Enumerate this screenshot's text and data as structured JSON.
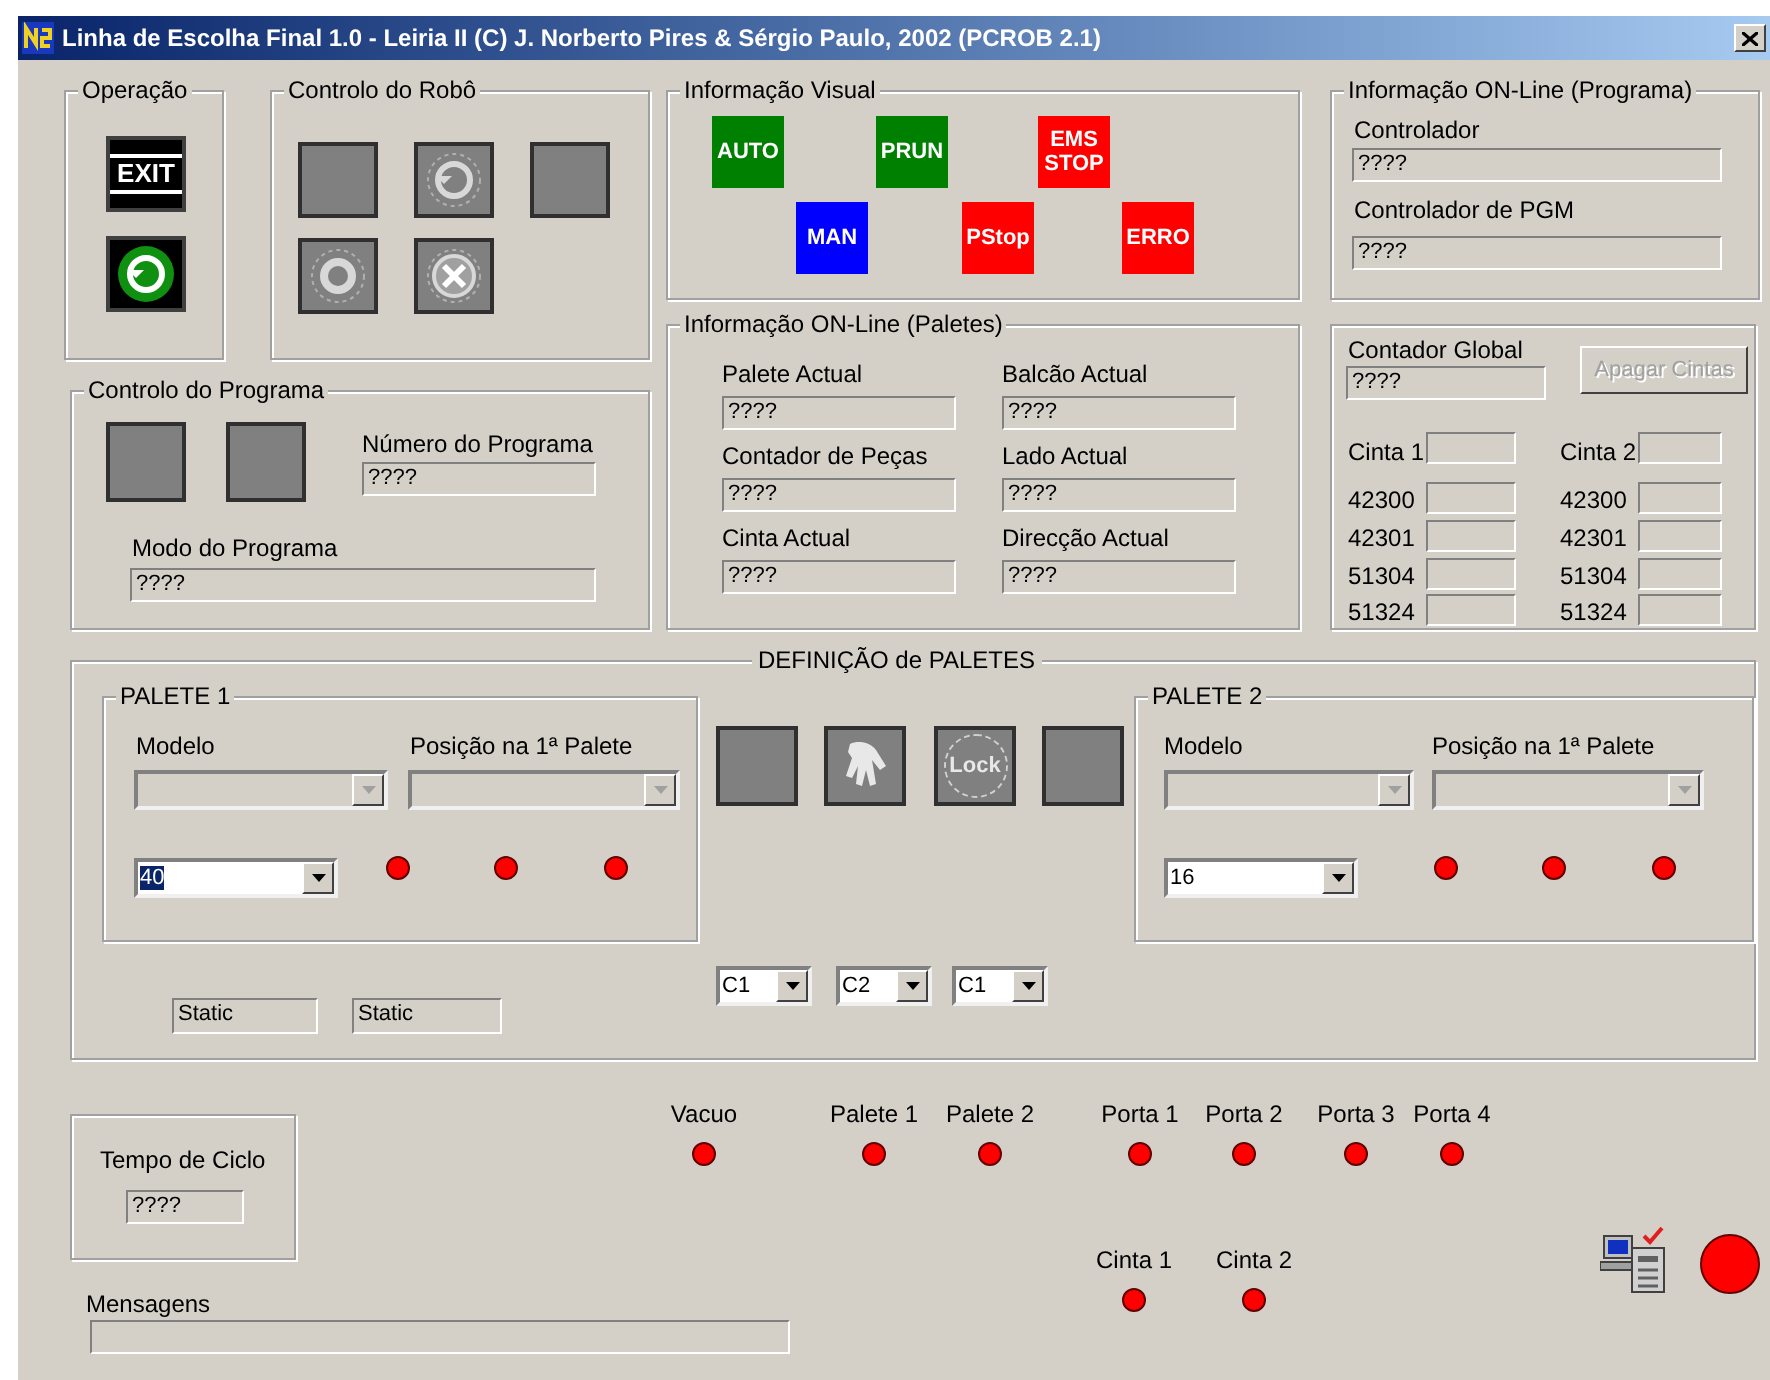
{
  "window": {
    "title": "Linha de Escolha Final 1.0 - Leiria II (C) J. Norberto Pires & Sérgio Paulo, 2002 (PCROB 2.1)"
  },
  "operacao": {
    "title": "Operação",
    "exit_label": "EXIT"
  },
  "controlo_robo": {
    "title": "Controlo do Robô",
    "buttons": [
      {
        "kind": "blank"
      },
      {
        "kind": "restart"
      },
      {
        "kind": "blank"
      },
      {
        "kind": "circle"
      },
      {
        "kind": "cancel"
      }
    ]
  },
  "controlo_programa": {
    "title": "Controlo do Programa",
    "numero_label": "Número do Programa",
    "numero_value": "????",
    "modo_label": "Modo do Programa",
    "modo_value": "????"
  },
  "informacao_visual": {
    "title": "Informação Visual",
    "indicators": [
      {
        "label": "AUTO",
        "color": "#008000"
      },
      {
        "label": "PRUN",
        "color": "#008000"
      },
      {
        "label": "EMS STOP",
        "color": "#ff0000"
      },
      {
        "label": "MAN",
        "color": "#0000ff"
      },
      {
        "label": "PStop",
        "color": "#ff0000"
      },
      {
        "label": "ERRO",
        "color": "#ff0000"
      }
    ]
  },
  "informacao_programa": {
    "title": "Informação ON-Line (Programa)",
    "fields": [
      {
        "label": "Controlador",
        "value": "????"
      },
      {
        "label": "Controlador de PGM",
        "value": "????"
      }
    ]
  },
  "informacao_paletes": {
    "title": "Informação ON-Line (Paletes)",
    "fields": [
      {
        "label": "Palete Actual",
        "value": "????"
      },
      {
        "label": "Balcão Actual",
        "value": "????"
      },
      {
        "label": "Contador de Peças",
        "value": "????"
      },
      {
        "label": "Lado Actual",
        "value": "????"
      },
      {
        "label": "Cinta Actual",
        "value": "????"
      },
      {
        "label": "Direcção Actual",
        "value": "????"
      }
    ]
  },
  "contadores": {
    "global_label": "Contador Global",
    "global_value": "????",
    "apagar_button": {
      "label": "Apagar Cintas",
      "disabled": true
    },
    "columns": [
      {
        "header": "Cinta 1",
        "rows": [
          "42300",
          "42301",
          "51304",
          "51324"
        ]
      },
      {
        "header": "Cinta 2",
        "rows": [
          "42300",
          "42301",
          "51304",
          "51324"
        ]
      }
    ]
  },
  "definicao_paletes": {
    "title": "DEFINIÇÃO de PALETES",
    "paletes": [
      {
        "title": "PALETE 1",
        "modelo_label": "Modelo",
        "posicao_label": "Posição na 1ª Palete",
        "count": "40",
        "count_selected": true
      },
      {
        "title": "PALETE 2",
        "modelo_label": "Modelo",
        "posicao_label": "Posição na 1ª Palete",
        "count": "16",
        "count_selected": false
      }
    ],
    "tool_buttons": [
      {
        "kind": "blank"
      },
      {
        "kind": "gripper"
      },
      {
        "kind": "lock",
        "label": "Lock"
      },
      {
        "kind": "blank"
      }
    ],
    "cintas": [
      "C1",
      "C2",
      "C1"
    ],
    "statics": [
      "Static",
      "Static"
    ]
  },
  "tempo_ciclo": {
    "label": "Tempo de Ciclo",
    "value": "????"
  },
  "mensagens": {
    "label": "Mensagens"
  },
  "sensores": [
    {
      "label": "Vacuo"
    },
    {
      "label": "Palete 1"
    },
    {
      "label": "Palete 2"
    },
    {
      "label": "Porta 1"
    },
    {
      "label": "Porta 2"
    },
    {
      "label": "Porta 3"
    },
    {
      "label": "Porta 4"
    },
    {
      "label": "Cinta 1"
    },
    {
      "label": "Cinta 2"
    }
  ]
}
